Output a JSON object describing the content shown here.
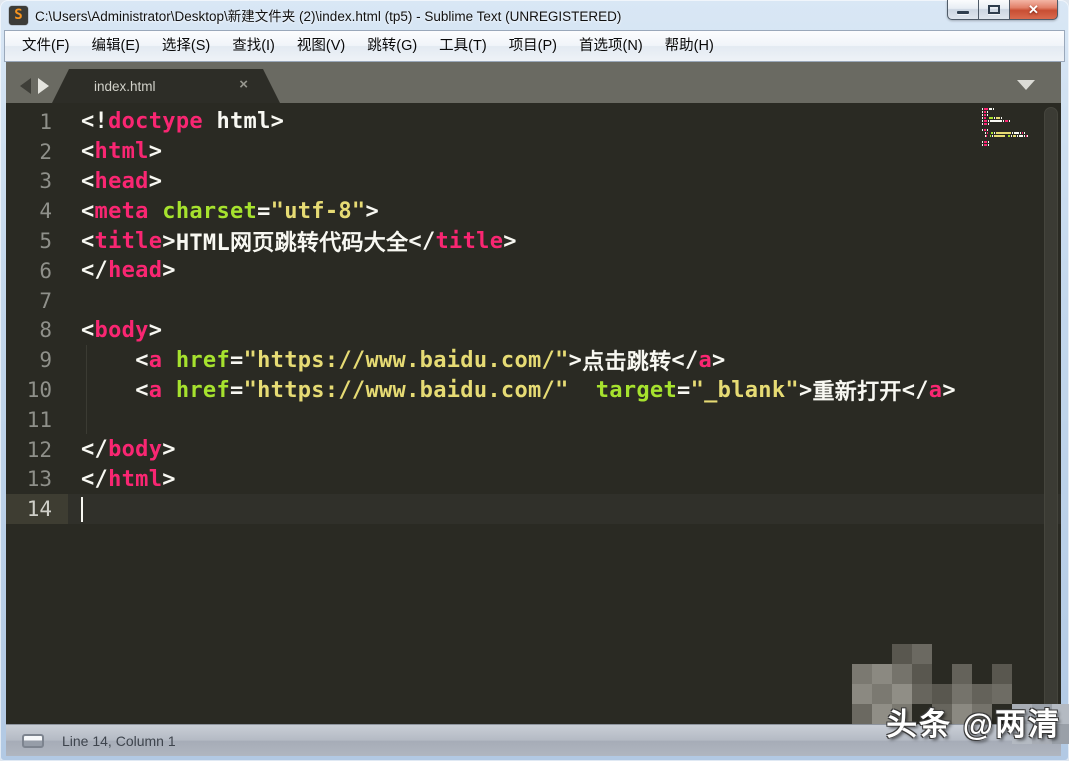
{
  "window": {
    "title": "C:\\Users\\Administrator\\Desktop\\新建文件夹 (2)\\index.html (tp5) - Sublime Text (UNREGISTERED)",
    "app_icon_letter": "S",
    "close_glyph": "✕"
  },
  "menu": {
    "items": [
      "文件(F)",
      "编辑(E)",
      "选择(S)",
      "查找(I)",
      "视图(V)",
      "跳转(G)",
      "工具(T)",
      "项目(P)",
      "首选项(N)",
      "帮助(H)"
    ]
  },
  "tab": {
    "label": "index.html",
    "close_glyph": "×",
    "active": true
  },
  "colors": {
    "tag": "#f92672",
    "attr": "#a6e22e",
    "str": "#e6db74",
    "txt": "#f8f8f2",
    "editor_bg": "#2a2a23",
    "gutter_text": "#8f908a",
    "current_line_bg": "#3e3d32"
  },
  "editor": {
    "language": "HTML",
    "lines": [
      {
        "num": 1,
        "segs": [
          [
            "<!",
            "txt"
          ],
          [
            "doctype",
            "tag"
          ],
          [
            " html",
            "txt"
          ],
          [
            ">",
            "txt"
          ]
        ]
      },
      {
        "num": 2,
        "segs": [
          [
            "<",
            "txt"
          ],
          [
            "html",
            "tag"
          ],
          [
            ">",
            "txt"
          ]
        ]
      },
      {
        "num": 3,
        "segs": [
          [
            "<",
            "txt"
          ],
          [
            "head",
            "tag"
          ],
          [
            ">",
            "txt"
          ]
        ]
      },
      {
        "num": 4,
        "segs": [
          [
            "<",
            "txt"
          ],
          [
            "meta",
            "tag"
          ],
          [
            " ",
            "txt"
          ],
          [
            "charset",
            "attr"
          ],
          [
            "=",
            "txt"
          ],
          [
            "\"utf-8\"",
            "str"
          ],
          [
            ">",
            "txt"
          ]
        ]
      },
      {
        "num": 5,
        "segs": [
          [
            "<",
            "txt"
          ],
          [
            "title",
            "tag"
          ],
          [
            ">",
            "txt"
          ],
          [
            "HTML网页跳转代码大全",
            "txt"
          ],
          [
            "</",
            "txt"
          ],
          [
            "title",
            "tag"
          ],
          [
            ">",
            "txt"
          ]
        ]
      },
      {
        "num": 6,
        "segs": [
          [
            "</",
            "txt"
          ],
          [
            "head",
            "tag"
          ],
          [
            ">",
            "txt"
          ]
        ]
      },
      {
        "num": 7,
        "segs": []
      },
      {
        "num": 8,
        "segs": [
          [
            "<",
            "txt"
          ],
          [
            "body",
            "tag"
          ],
          [
            ">",
            "txt"
          ]
        ]
      },
      {
        "num": 9,
        "segs": [
          [
            "    ",
            "txt"
          ],
          [
            "<",
            "txt"
          ],
          [
            "a",
            "tag"
          ],
          [
            " ",
            "txt"
          ],
          [
            "href",
            "attr"
          ],
          [
            "=",
            "txt"
          ],
          [
            "\"https://www.baidu.com/\"",
            "str"
          ],
          [
            ">",
            "txt"
          ],
          [
            "点击跳转",
            "txt"
          ],
          [
            "</",
            "txt"
          ],
          [
            "a",
            "tag"
          ],
          [
            ">",
            "txt"
          ]
        ]
      },
      {
        "num": 10,
        "segs": [
          [
            "    ",
            "txt"
          ],
          [
            "<",
            "txt"
          ],
          [
            "a",
            "tag"
          ],
          [
            " ",
            "txt"
          ],
          [
            "href",
            "attr"
          ],
          [
            "=",
            "txt"
          ],
          [
            "\"https://www.baidu.com/\"",
            "str"
          ],
          [
            "  ",
            "txt"
          ],
          [
            "target",
            "attr"
          ],
          [
            "=",
            "txt"
          ],
          [
            "\"_blank\"",
            "str"
          ],
          [
            ">",
            "txt"
          ],
          [
            "重新打开",
            "txt"
          ],
          [
            "</",
            "txt"
          ],
          [
            "a",
            "tag"
          ],
          [
            ">",
            "txt"
          ]
        ]
      },
      {
        "num": 11,
        "segs": []
      },
      {
        "num": 12,
        "segs": [
          [
            "</",
            "txt"
          ],
          [
            "body",
            "tag"
          ],
          [
            ">",
            "txt"
          ]
        ]
      },
      {
        "num": 13,
        "segs": [
          [
            "</",
            "txt"
          ],
          [
            "html",
            "tag"
          ],
          [
            ">",
            "txt"
          ]
        ]
      },
      {
        "num": 14,
        "segs": [],
        "cursor": true,
        "current": true
      }
    ]
  },
  "status_bar": {
    "text": "Line 14, Column 1"
  },
  "watermark": {
    "text": "头条 @两清"
  }
}
